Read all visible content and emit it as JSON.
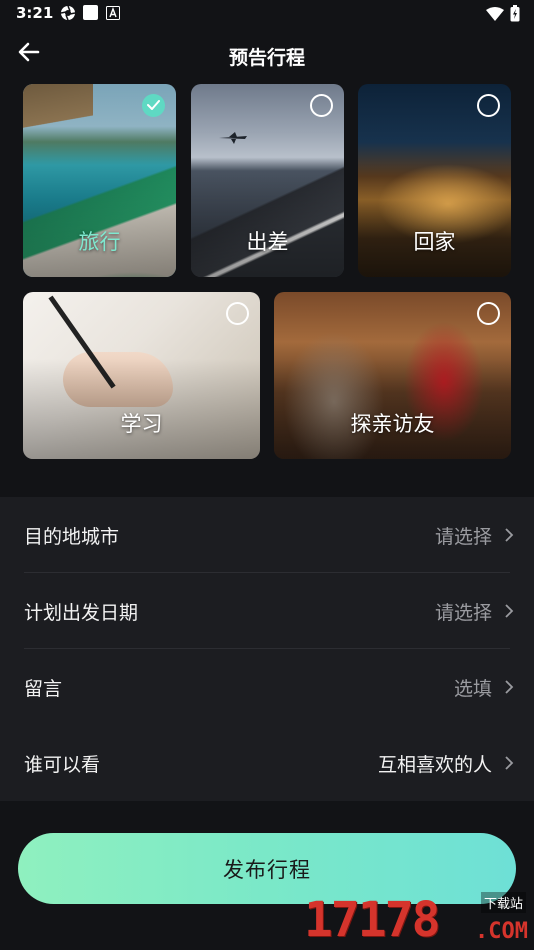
{
  "status_bar": {
    "time": "3:21",
    "left_icons": [
      "aperture-icon",
      "square-icon",
      "a-box-icon"
    ],
    "right_icons": [
      "wifi-icon",
      "battery-charging-icon"
    ]
  },
  "header": {
    "title": "预告行程",
    "back_icon": "arrow-left-icon"
  },
  "trip_types": [
    {
      "label": "旅行",
      "selected": true
    },
    {
      "label": "出差",
      "selected": false
    },
    {
      "label": "回家",
      "selected": false
    },
    {
      "label": "学习",
      "selected": false
    },
    {
      "label": "探亲访友",
      "selected": false
    }
  ],
  "form": {
    "rows": [
      {
        "label": "目的地城市",
        "value": "请选择"
      },
      {
        "label": "计划出发日期",
        "value": "请选择"
      },
      {
        "label": "留言",
        "value": "选填"
      },
      {
        "label": "谁可以看",
        "value": "互相喜欢的人"
      }
    ]
  },
  "publish": {
    "label": "发布行程"
  },
  "watermark": {
    "number": "17178",
    "domain": ".COM",
    "site": "下载站"
  },
  "colors": {
    "background": "#121316",
    "list_background": "#1c1d21",
    "accent": "#5fd9c3",
    "publish_gradient_start": "#8ff0bf",
    "publish_gradient_end": "#6ee0d6"
  }
}
